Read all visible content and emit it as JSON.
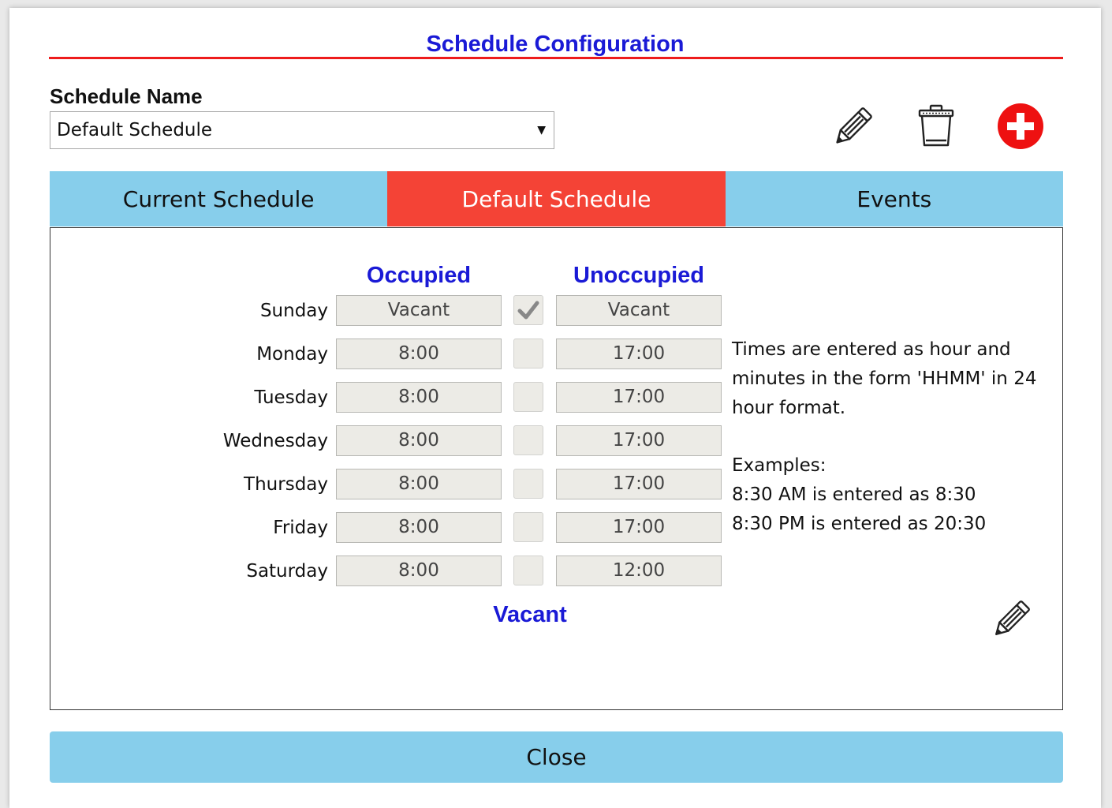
{
  "dialog": {
    "title": "Schedule Configuration"
  },
  "schedule_name": {
    "label": "Schedule Name",
    "selected": "Default Schedule"
  },
  "toolbar": {
    "edit_icon": "pencil-icon",
    "delete_icon": "trash-icon",
    "add_icon": "plus-circle-icon"
  },
  "tabs": [
    {
      "label": "Current Schedule",
      "active": false
    },
    {
      "label": "Default Schedule",
      "active": true
    },
    {
      "label": "Events",
      "active": false
    }
  ],
  "schedule": {
    "occupied_header": "Occupied",
    "unoccupied_header": "Unoccupied",
    "vacant_label": "Vacant",
    "days": [
      {
        "day": "Sunday",
        "occupied": "Vacant",
        "vacant": true,
        "unoccupied": "Vacant"
      },
      {
        "day": "Monday",
        "occupied": "8:00",
        "vacant": false,
        "unoccupied": "17:00"
      },
      {
        "day": "Tuesday",
        "occupied": "8:00",
        "vacant": false,
        "unoccupied": "17:00"
      },
      {
        "day": "Wednesday",
        "occupied": "8:00",
        "vacant": false,
        "unoccupied": "17:00"
      },
      {
        "day": "Thursday",
        "occupied": "8:00",
        "vacant": false,
        "unoccupied": "17:00"
      },
      {
        "day": "Friday",
        "occupied": "8:00",
        "vacant": false,
        "unoccupied": "17:00"
      },
      {
        "day": "Saturday",
        "occupied": "8:00",
        "vacant": false,
        "unoccupied": "12:00"
      }
    ]
  },
  "help": {
    "intro": "Times are entered as hour and minutes in the form 'HHMM' in 24 hour format.",
    "examples_title": "Examples:",
    "example_1": "8:30 AM is entered as 8:30",
    "example_2": "8:30 PM is entered as 20:30"
  },
  "close_label": "Close",
  "colors": {
    "title": "#1a1ad6",
    "rule": "#ee1c1c",
    "tab_inactive": "#87ceeb",
    "tab_active": "#f44336",
    "add_button": "#ee1111",
    "close_button": "#87ceeb"
  }
}
